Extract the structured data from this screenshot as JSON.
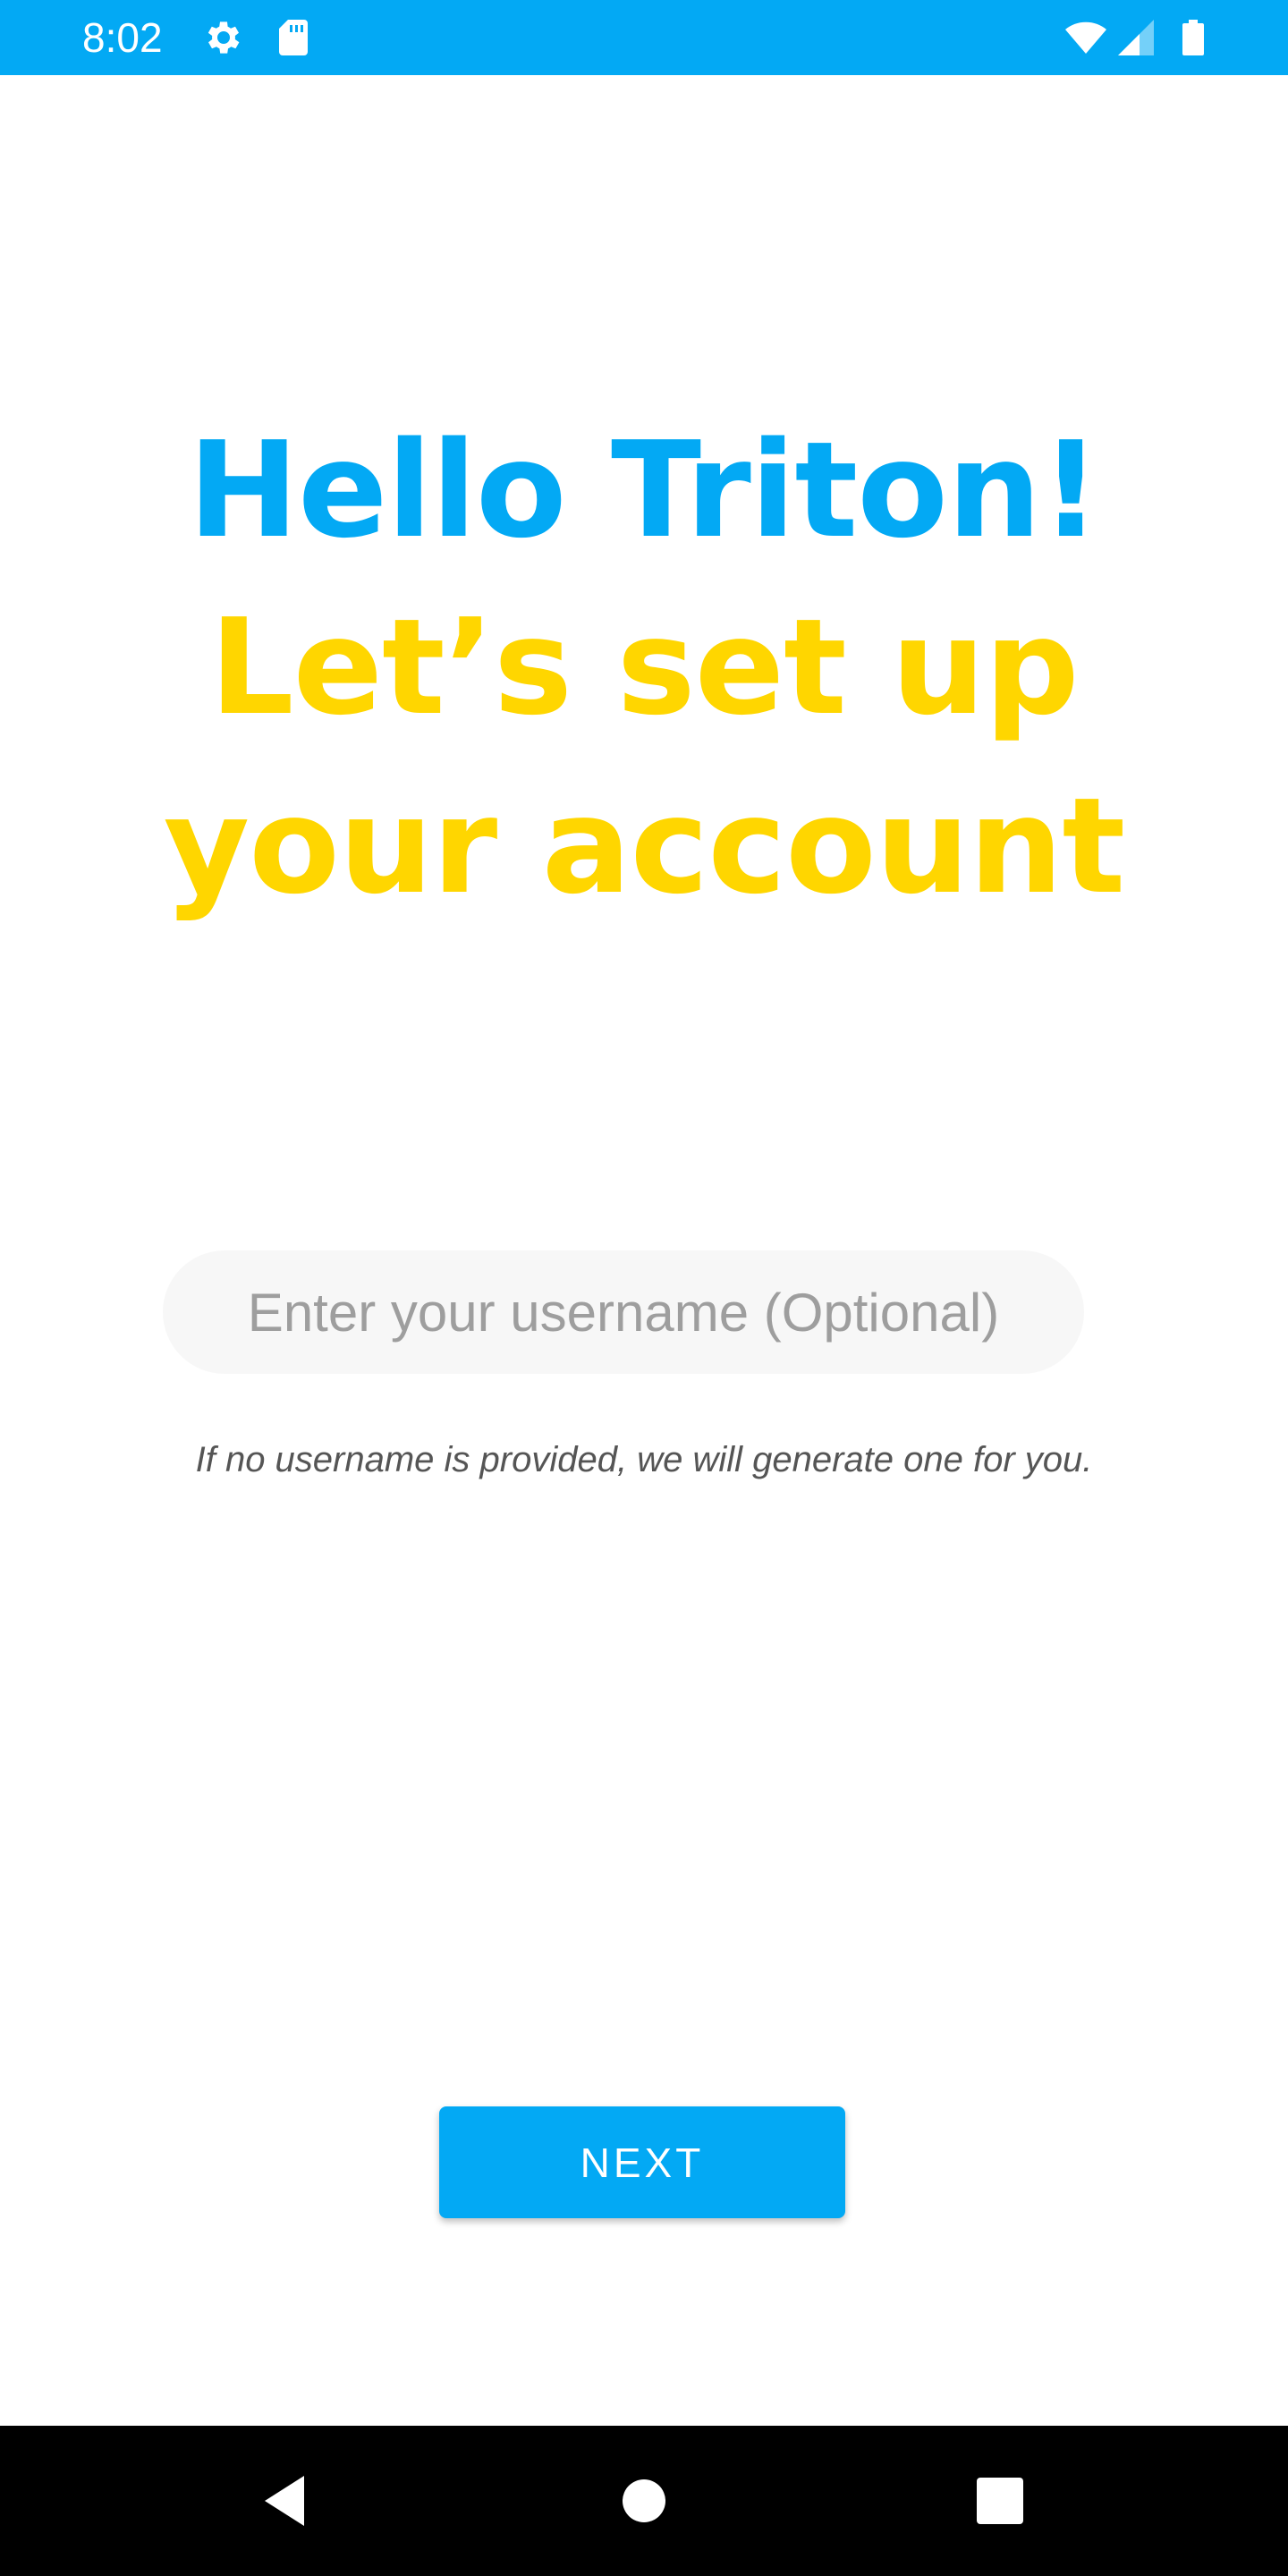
{
  "status_bar": {
    "time": "8:02",
    "icons": [
      "gear-icon",
      "sd-card-icon",
      "wifi-icon",
      "cell-signal-icon",
      "battery-icon"
    ],
    "background": "#03A9F4"
  },
  "headline": {
    "greeting": "Hello Triton!",
    "line2": "Let’s set up",
    "line3": "your account",
    "greeting_color": "#03A9F4",
    "setup_color": "#FFD600"
  },
  "username": {
    "value": "",
    "placeholder": "Enter your username (Optional)",
    "hint": "If no username is provided, we will generate one for you."
  },
  "actions": {
    "next_label": "NEXT",
    "accent": "#03A9F4"
  },
  "nav_bar": {
    "buttons": [
      "back-icon",
      "home-icon",
      "recents-icon"
    ]
  }
}
